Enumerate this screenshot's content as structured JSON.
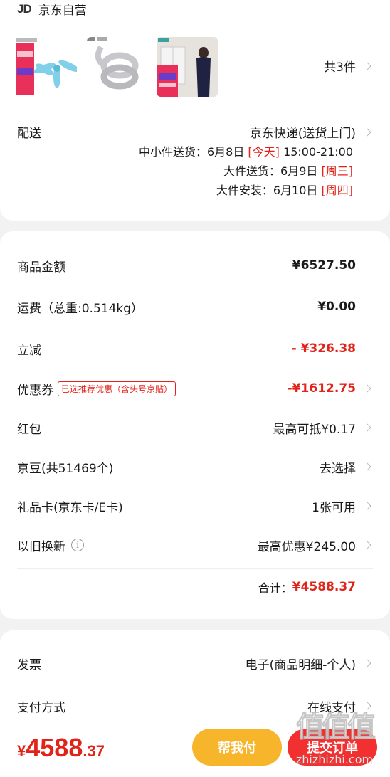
{
  "store": {
    "logo": "JD",
    "name": "京东自营"
  },
  "items": {
    "count_label": "共3件"
  },
  "delivery": {
    "label": "配送",
    "method": "京东快递(送货上门)",
    "lines": [
      {
        "prefix": "中小件送货：6月8日 ",
        "tag": "[今天]",
        "suffix": " 15:00-21:00"
      },
      {
        "prefix": "大件送货：6月9日 ",
        "tag": "[周三]",
        "suffix": ""
      },
      {
        "prefix": "大件安装：6月10日 ",
        "tag": "[周四]",
        "suffix": ""
      }
    ]
  },
  "summary": {
    "goods_label": "商品金额",
    "goods_value": "¥6527.50",
    "shipping_label": "运费（总重:0.514kg）",
    "shipping_value": "¥0.00",
    "discount_label": "立减",
    "discount_value": "- ¥326.38",
    "coupon_label": "优惠券",
    "coupon_tag": "已选推荐优惠（含头号京贴）",
    "coupon_value": "-¥1612.75",
    "redpacket_label": "红包",
    "redpacket_value": "最高可抵¥0.17",
    "beans_label": "京豆(共51469个)",
    "beans_value": "去选择",
    "giftcard_label": "礼品卡(京东卡/E卡)",
    "giftcard_value": "1张可用",
    "tradein_label": "以旧换新",
    "tradein_value": "最高优惠¥245.00",
    "total_label": "合计：",
    "total_value": "¥4588.37"
  },
  "invoice": {
    "label": "发票",
    "value": "电子(商品明细-个人)"
  },
  "payment": {
    "label": "支付方式",
    "value": "在线支付"
  },
  "bottom": {
    "price_symbol": "¥",
    "price_int": "4588",
    "price_dec": ".37",
    "help_pay": "帮我付",
    "submit": "提交订单"
  },
  "watermark": {
    "text": "值值值",
    "url": "zhizhizhi.com"
  },
  "colors": {
    "accent_red": "#e2231a",
    "help_pay_yellow": "#f7b52c",
    "submit_red": "#f23030"
  }
}
